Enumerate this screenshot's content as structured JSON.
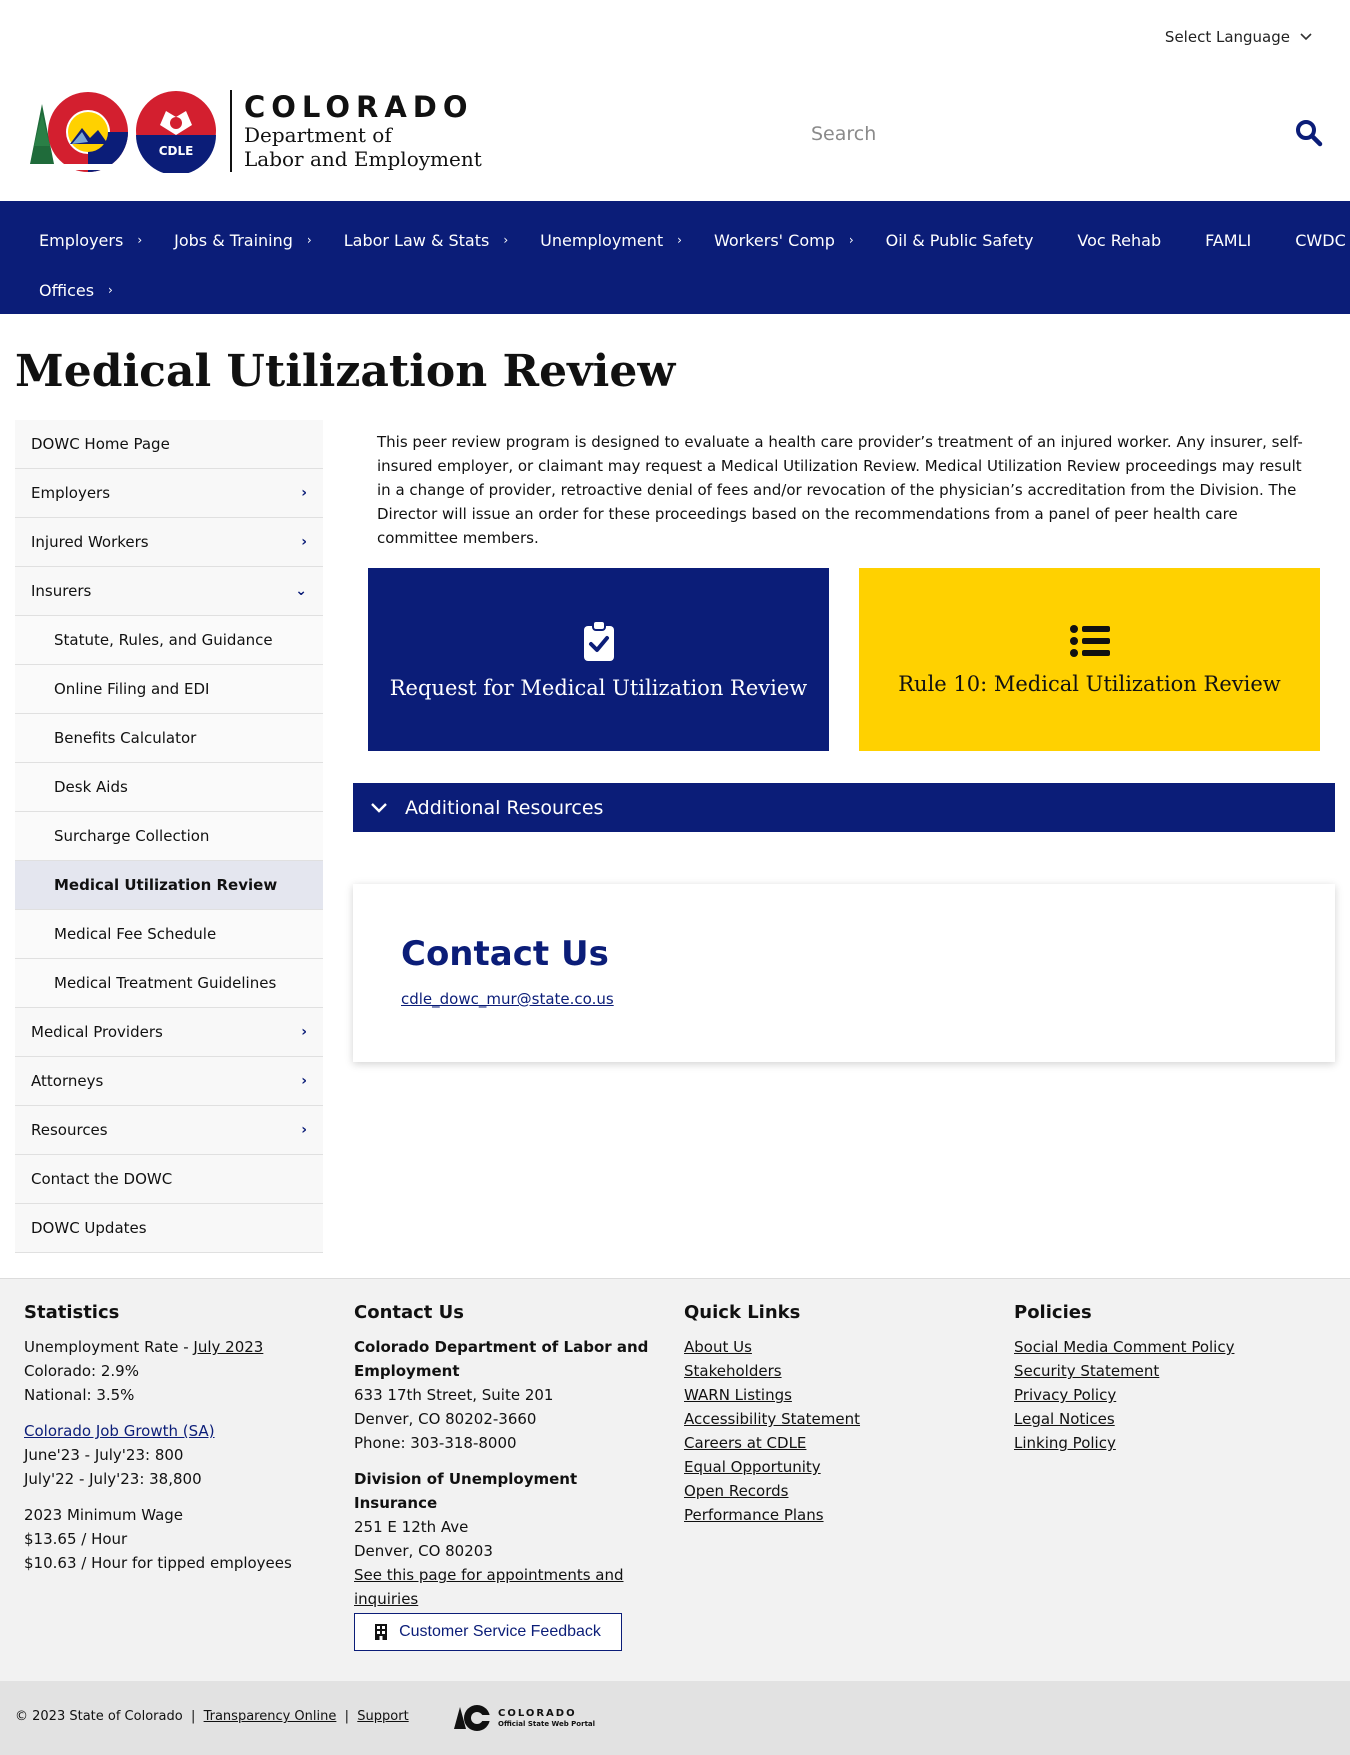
{
  "language": {
    "label": "Select Language"
  },
  "logo": {
    "state": "COLORADO",
    "dept_line1": "Department of",
    "dept_line2": "Labor and Employment",
    "badge": "CDLE"
  },
  "search": {
    "placeholder": "Search"
  },
  "nav": {
    "row1": [
      {
        "label": "Employers",
        "has_children": true
      },
      {
        "label": "Jobs & Training",
        "has_children": true
      },
      {
        "label": "Labor Law & Stats",
        "has_children": true
      },
      {
        "label": "Unemployment",
        "has_children": true
      },
      {
        "label": "Workers' Comp",
        "has_children": true
      },
      {
        "label": "Oil & Public Safety",
        "has_children": false
      },
      {
        "label": "Voc Rehab",
        "has_children": false
      },
      {
        "label": "FAMLI",
        "has_children": false
      },
      {
        "label": "CWDC",
        "has_children": false
      }
    ],
    "row2": [
      {
        "label": "Offices",
        "has_children": true
      }
    ]
  },
  "page": {
    "title": "Medical Utilization Review"
  },
  "sidebar": {
    "items": [
      {
        "label": "DOWC Home Page",
        "level": 1,
        "indicator": ""
      },
      {
        "label": "Employers",
        "level": 1,
        "indicator": "›"
      },
      {
        "label": "Injured Workers",
        "level": 1,
        "indicator": "›"
      },
      {
        "label": "Insurers",
        "level": 1,
        "indicator": "⌄"
      },
      {
        "label": "Statute, Rules, and Guidance",
        "level": 2,
        "indicator": ""
      },
      {
        "label": "Online Filing and EDI",
        "level": 2,
        "indicator": ""
      },
      {
        "label": "Benefits Calculator",
        "level": 2,
        "indicator": ""
      },
      {
        "label": "Desk Aids",
        "level": 2,
        "indicator": ""
      },
      {
        "label": "Surcharge Collection",
        "level": 2,
        "indicator": ""
      },
      {
        "label": "Medical Utilization Review",
        "level": 2,
        "indicator": "",
        "active": true
      },
      {
        "label": "Medical Fee Schedule",
        "level": 2,
        "indicator": ""
      },
      {
        "label": "Medical Treatment Guidelines",
        "level": 2,
        "indicator": ""
      },
      {
        "label": "Medical Providers",
        "level": 1,
        "indicator": "›"
      },
      {
        "label": "Attorneys",
        "level": 1,
        "indicator": "›"
      },
      {
        "label": "Resources",
        "level": 1,
        "indicator": "›"
      },
      {
        "label": "Contact the DOWC",
        "level": 1,
        "indicator": ""
      },
      {
        "label": "DOWC Updates",
        "level": 1,
        "indicator": ""
      }
    ]
  },
  "main": {
    "intro": "This peer review program is designed to evaluate a health care provider’s treatment of an injured worker. Any insurer, self-insured employer, or claimant may request a Medical Utilization Review. Medical Utilization Review proceedings may result in a change of provider, retroactive denial of fees and/or revocation of the physician’s accreditation from the Division.  The Director will issue an order for these proceedings based on the recommendations from a panel of peer health care committee members.",
    "card_request": {
      "label": "Request for Medical Utilization Review",
      "icon": "clipboard-check-icon",
      "bg": "#0b1d78"
    },
    "card_rule": {
      "label": "Rule 10: Medical Utilization Review",
      "icon": "list-icon",
      "bg": "#ffd100"
    },
    "accordion": {
      "label": "Additional Resources"
    },
    "contact": {
      "title": "Contact Us",
      "email": "cdle_dowc_mur@state.co.us"
    }
  },
  "footer": {
    "statistics": {
      "heading": "Statistics",
      "unemp_prefix": "Unemployment Rate - ",
      "unemp_link": "July 2023",
      "colorado": "Colorado: 2.9%",
      "national": "National: 3.5%",
      "job_growth_link": "Colorado Job Growth (SA)",
      "growth_1": "June'23 - July'23: 800",
      "growth_2": "July'22 - July'23: 38,800",
      "wage_title": "2023 Minimum Wage",
      "wage_1": "$13.65 / Hour",
      "wage_2": "$10.63 / Hour for tipped employees"
    },
    "contact": {
      "heading": "Contact Us",
      "org": "Colorado Department of Labor and Employment",
      "addr1": "633 17th Street, Suite 201",
      "addr2": "Denver, CO  80202-3660",
      "phone": "Phone: 303-318-8000",
      "div_title": "Division of Unemployment Insurance",
      "div_addr1": "251 E 12th Ave",
      "div_addr2": "Denver, CO  80203",
      "div_link": "See this page for appointments and inquiries",
      "feedback": "Customer Service Feedback"
    },
    "quick_links": {
      "heading": "Quick Links",
      "items": [
        "About Us",
        "Stakeholders",
        "WARN Listings",
        "Accessibility Statement",
        "Careers at CDLE",
        "Equal Opportunity",
        "Open Records",
        "Performance Plans"
      ]
    },
    "policies": {
      "heading": "Policies",
      "items": [
        "Social Media Comment Policy",
        "Security Statement",
        "Privacy Policy",
        "Legal Notices",
        "Linking Policy"
      ]
    }
  },
  "bottom": {
    "copyright": "© 2023 State of Colorado",
    "sep": "|",
    "transparency": "Transparency Online",
    "support": "Support",
    "portal_name": "COLORADO",
    "portal_sub": "Official State Web Portal"
  },
  "colors": {
    "navy": "#0b1d78",
    "yellow": "#ffd100",
    "red": "#d31f2f"
  }
}
